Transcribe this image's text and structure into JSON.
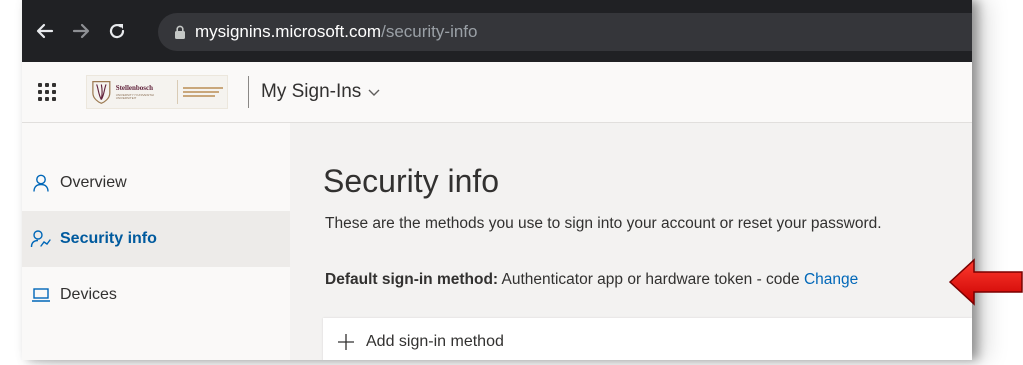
{
  "browser": {
    "url_host": "mysignins.microsoft.com",
    "url_path": "/security-info"
  },
  "header": {
    "logo_text": "Stellenbosch",
    "logo_subtext": "UNIVERSITY IYUNIVESITHI UNIVERSITEIT",
    "app_title": "My Sign-Ins"
  },
  "sidebar": {
    "items": [
      {
        "label": "Overview",
        "icon": "person-icon",
        "active": false
      },
      {
        "label": "Security info",
        "icon": "security-info-icon",
        "active": true
      },
      {
        "label": "Devices",
        "icon": "laptop-icon",
        "active": false
      }
    ]
  },
  "main": {
    "title": "Security info",
    "description": "These are the methods you use to sign into your account or reset your password.",
    "default_method_label": "Default sign-in method:",
    "default_method_value": "Authenticator app or hardware token - code",
    "change_label": "Change",
    "add_method_label": "Add sign-in method"
  },
  "colors": {
    "accent": "#0067b8",
    "active_nav_text": "#005a9e",
    "annotation_arrow": "#e00000",
    "browser_bar": "#202124"
  }
}
